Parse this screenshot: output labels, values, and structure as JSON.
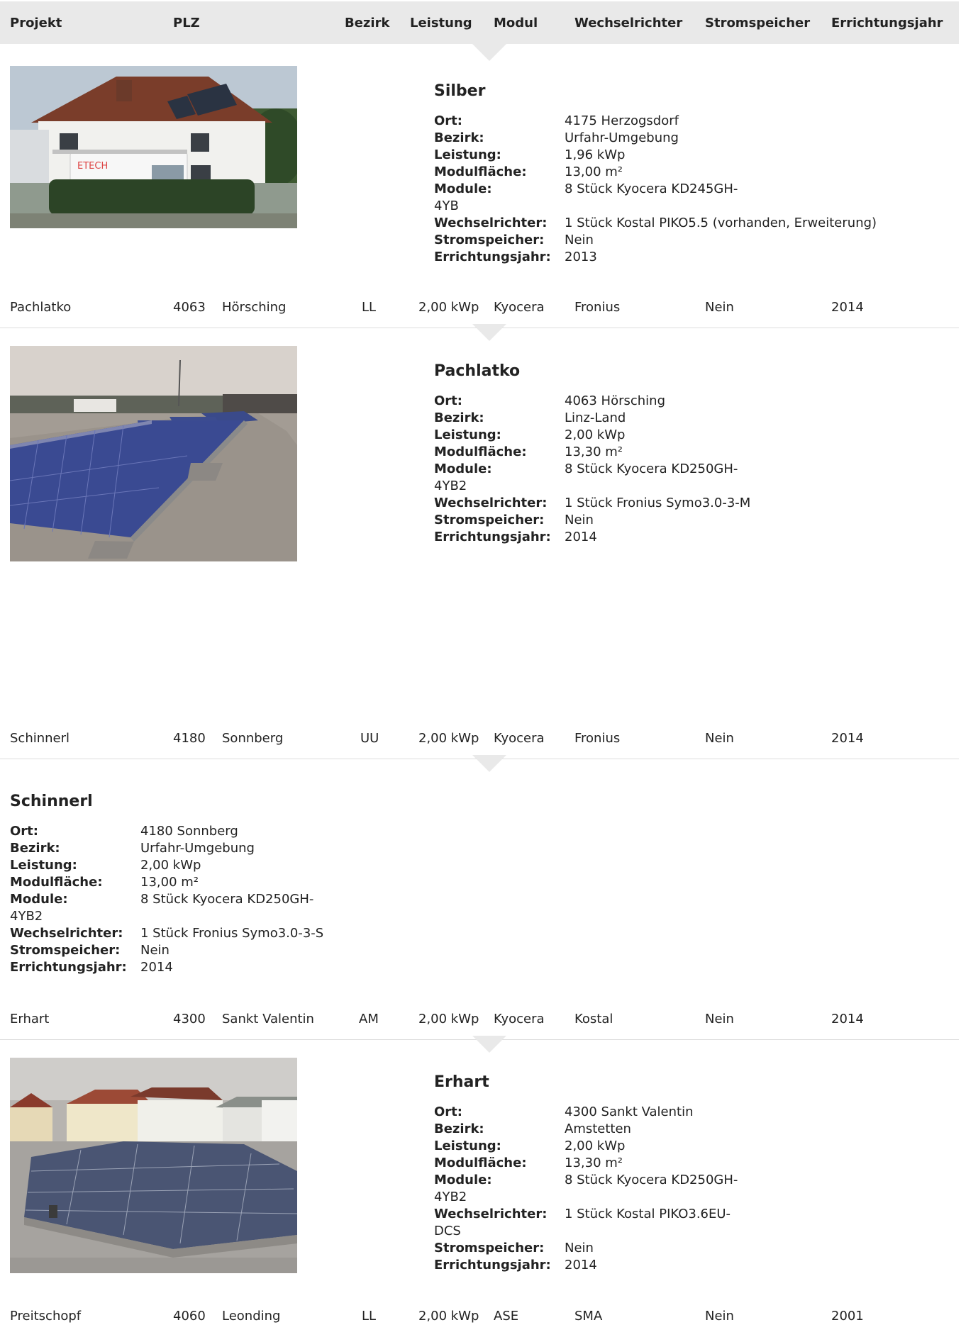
{
  "header": {
    "projekt": "Projekt",
    "plz": "PLZ",
    "bezirk": "Bezirk",
    "leistung": "Leistung",
    "modul": "Modul",
    "wechselrichter": "Wechselrichter",
    "stromspeicher": "Stromspeicher",
    "errichtungsjahr": "Errichtungsjahr"
  },
  "labels": {
    "ort": "Ort:",
    "bezirk": "Bezirk:",
    "leistung": "Leistung:",
    "modulflaeche": "Modulfläche:",
    "module": "Module:",
    "wechselrichter": "Wechselrichter:",
    "stromspeicher": "Stromspeicher:",
    "errichtungsjahr": "Errichtungsjahr:"
  },
  "details": [
    {
      "title": "Silber",
      "ort": "4175 Herzogsdorf",
      "bezirk": "Urfahr-Umgebung",
      "leistung": "1,96 kWp",
      "modulflaeche": "13,00 m²",
      "module_a": "8 Stück Kyocera KD245GH-",
      "module_b": "4YB",
      "wechselrichter_a": "1 Stück Kostal PIKO5.5 (vorhanden, Erweiterung)",
      "wechselrichter_b": "",
      "stromspeicher": "Nein",
      "errichtungsjahr": "2013"
    },
    {
      "title": "Pachlatko",
      "ort": "4063 Hörsching",
      "bezirk": "Linz-Land",
      "leistung": "2,00 kWp",
      "modulflaeche": "13,30 m²",
      "module_a": "8 Stück Kyocera KD250GH-",
      "module_b": "4YB2",
      "wechselrichter_a": "1 Stück Fronius Symo3.0-3-M",
      "wechselrichter_b": "",
      "stromspeicher": "Nein",
      "errichtungsjahr": "2014"
    },
    {
      "title": "Schinnerl",
      "ort": "4180 Sonnberg",
      "bezirk": "Urfahr-Umgebung",
      "leistung": "2,00 kWp",
      "modulflaeche": "13,00 m²",
      "module_a": "8 Stück Kyocera KD250GH-",
      "module_b": "4YB2",
      "wechselrichter_a": "1 Stück Fronius Symo3.0-3-S",
      "wechselrichter_b": "",
      "stromspeicher": "Nein",
      "errichtungsjahr": "2014"
    },
    {
      "title": "Erhart",
      "ort": "4300 Sankt Valentin",
      "bezirk": "Amstetten",
      "leistung": "2,00 kWp",
      "modulflaeche": "13,30 m²",
      "module_a": "8 Stück Kyocera KD250GH-",
      "module_b": "4YB2",
      "wechselrichter_a": "1 Stück Kostal PIKO3.6EU-",
      "wechselrichter_b": "DCS",
      "stromspeicher": "Nein",
      "errichtungsjahr": "2014"
    }
  ],
  "rows": [
    {
      "projekt": "Pachlatko",
      "plz": "4063",
      "ort": "Hörsching",
      "bezirk": "LL",
      "leistung": "2,00 kWp",
      "modul": "Kyocera",
      "wechselrichter": "Fronius",
      "stromspeicher": "Nein",
      "errichtungsjahr": "2014"
    },
    {
      "projekt": "Schinnerl",
      "plz": "4180",
      "ort": "Sonnberg",
      "bezirk": "UU",
      "leistung": "2,00 kWp",
      "modul": "Kyocera",
      "wechselrichter": "Fronius",
      "stromspeicher": "Nein",
      "errichtungsjahr": "2014"
    },
    {
      "projekt": "Erhart",
      "plz": "4300",
      "ort": "Sankt Valentin",
      "bezirk": "AM",
      "leistung": "2,00 kWp",
      "modul": "Kyocera",
      "wechselrichter": "Kostal",
      "stromspeicher": "Nein",
      "errichtungsjahr": "2014"
    },
    {
      "projekt": "Preitschopf",
      "plz": "4060",
      "ort": "Leonding",
      "bezirk": "LL",
      "leistung": "2,00 kWp",
      "modul": "ASE",
      "wechselrichter": "SMA",
      "stromspeicher": "Nein",
      "errichtungsjahr": "2001"
    }
  ]
}
